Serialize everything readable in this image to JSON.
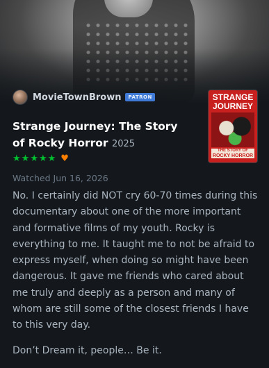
{
  "review": {
    "author": "MovieTownBrown",
    "badge": "PATRON",
    "film_title": "Strange Journey: The Story of Rocky Horror",
    "year": "2025",
    "rating_stars": 5,
    "liked": true,
    "watched_label": "Watched Jun 16, 2026",
    "paragraphs": [
      "No. I certainly did NOT cry 60-70 times during this documentary about one of the more important and formative films of my youth. Rocky is everything to me. It taught me to not be afraid to express myself, when doing so might have been dangerous. It gave me friends who cared about me truly and deeply as a person and many of whom are still some of the closest friends I have to this very day.",
      "Don’t Dream it, people… Be it."
    ]
  },
  "poster": {
    "title_line1": "STRANGE",
    "title_line2": "JOURNEY",
    "sub_line1": "THE STORY OF",
    "sub_line2": "ROCKY HORROR"
  },
  "colors": {
    "background": "#14181c",
    "star": "#00c030",
    "heart": "#ff8000",
    "patron_badge": "#3f7bd6",
    "poster": "#c8201e"
  },
  "icons": {
    "star": "star-icon",
    "heart": "heart-icon"
  }
}
